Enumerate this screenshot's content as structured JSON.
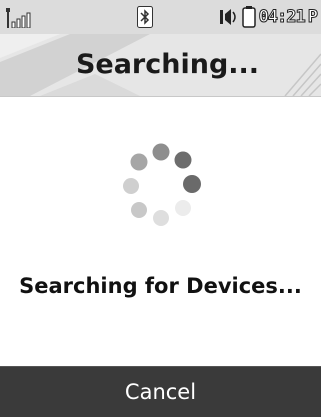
{
  "status_bar": {
    "time": "04:21",
    "time_suffix": "P",
    "icons": [
      "signal-icon",
      "bluetooth-icon",
      "speaker-icon",
      "battery-icon"
    ]
  },
  "header": {
    "title": "Searching..."
  },
  "content": {
    "spinner_icon": "loading-spinner-icon",
    "message": "Searching for Devices..."
  },
  "softkey": {
    "cancel_label": "Cancel"
  },
  "colors": {
    "status_bar_bg": "#dcdcdc",
    "header_bg": "#e6e6e6",
    "softkey_bg": "#3a3a3a",
    "text": "#111111"
  }
}
